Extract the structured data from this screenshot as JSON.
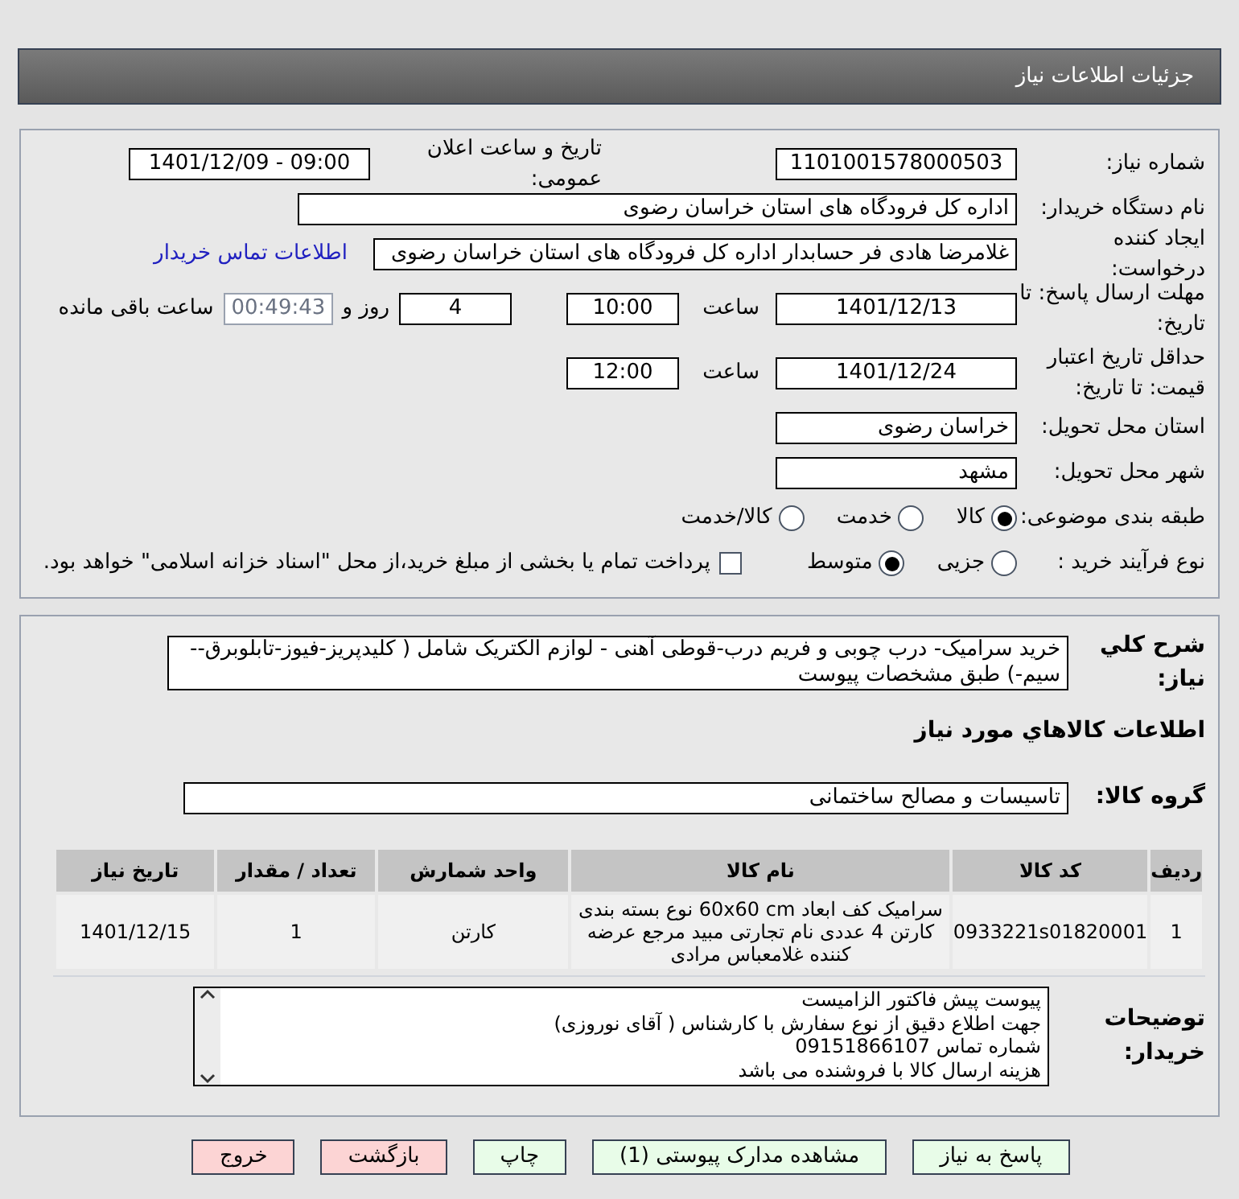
{
  "header": {
    "title": "جزئیات اطلاعات نیاز"
  },
  "need_number": {
    "label": "شماره نیاز:",
    "value": "1101001578000503"
  },
  "announce": {
    "label": "تاریخ و ساعت اعلان عمومی:",
    "value": "1401/12/09 - 09:00"
  },
  "buyer_org": {
    "label": "نام دستگاه خریدار:",
    "value": "اداره کل فرودگاه های استان خراسان رضوی"
  },
  "requester": {
    "label": "ایجاد کننده درخواست:",
    "value": "غلامرضا هادی فر حسابدار اداره کل فرودگاه های استان خراسان رضوی",
    "link": "اطلاعات تماس خریدار"
  },
  "deadline": {
    "label": "مهلت ارسال پاسخ: تا تاریخ:",
    "date": "1401/12/13",
    "time_label": "ساعت",
    "time": "10:00",
    "days": "4",
    "days_label": "روز و",
    "remaining": "00:49:43",
    "remaining_label": "ساعت باقی مانده"
  },
  "validity": {
    "label": "حداقل تاریخ اعتبار قیمت: تا تاریخ:",
    "date": "1401/12/24",
    "time_label": "ساعت",
    "time": "12:00"
  },
  "province": {
    "label": "استان محل تحویل:",
    "value": "خراسان رضوی"
  },
  "city": {
    "label": "شهر محل تحویل:",
    "value": "مشهد"
  },
  "category": {
    "label": "طبقه بندی موضوعی:",
    "options": [
      {
        "label": "کالا",
        "selected": true
      },
      {
        "label": "خدمت",
        "selected": false
      },
      {
        "label": "کالا/خدمت",
        "selected": false
      }
    ]
  },
  "process": {
    "label": "نوع فرآیند خرید :",
    "options": [
      {
        "label": "جزیی",
        "selected": false
      },
      {
        "label": "متوسط",
        "selected": true
      }
    ],
    "payment": {
      "checked": false,
      "label": "پرداخت تمام یا بخشی از مبلغ خرید،از محل \"اسناد خزانه اسلامی\" خواهد بود."
    }
  },
  "description": {
    "label": "شرح کلي نياز:",
    "value": "خرید سرامیک- درب چوبی و فریم درب-قوطی آهنی - لوازم الکتریک شامل ( کلیدپریز-فیوز-تابلوبرق--سیم-) طبق مشخصات پیوست"
  },
  "goods_title": "اطلاعات کالاهاي مورد نياز",
  "goods_group": {
    "label": "گروه کالا:",
    "value": "تاسیسات و مصالح ساختمانی"
  },
  "table": {
    "columns": [
      "ردیف",
      "کد کالا",
      "نام کالا",
      "واحد شمارش",
      "تعداد / مقدار",
      "تاریخ نیاز"
    ],
    "rows": [
      [
        "1",
        "0933221s01820001",
        "سرامیک کف ابعاد 60x60 cm نوع بسته بندی کارتن 4 عددی نام تجارتی مبید مرجع عرضه کننده غلامعباس مرادی",
        "کارتن",
        "1",
        "1401/12/15"
      ]
    ]
  },
  "buyer_notes": {
    "label": "توضیحات خریدار:",
    "lines": [
      "پیوست پیش فاکتور الزامیست",
      "جهت اطلاع دقیق از نوع سفارش با کارشناس  ( آقای نوروزی)",
      "شماره تماس 09151866107",
      "هزینه ارسال کالا با فروشنده می باشد"
    ]
  },
  "buttons": [
    {
      "label": "پاسخ به نیاز",
      "color": "#e8fce8"
    },
    {
      "label": "مشاهده مدارک پیوستی (1)",
      "color": "#e8fce8"
    },
    {
      "label": "چاپ",
      "color": "#e8fce8"
    },
    {
      "label": "بازگشت",
      "color": "#fcd4d4"
    },
    {
      "label": "خروج",
      "color": "#fcd4d4"
    }
  ]
}
